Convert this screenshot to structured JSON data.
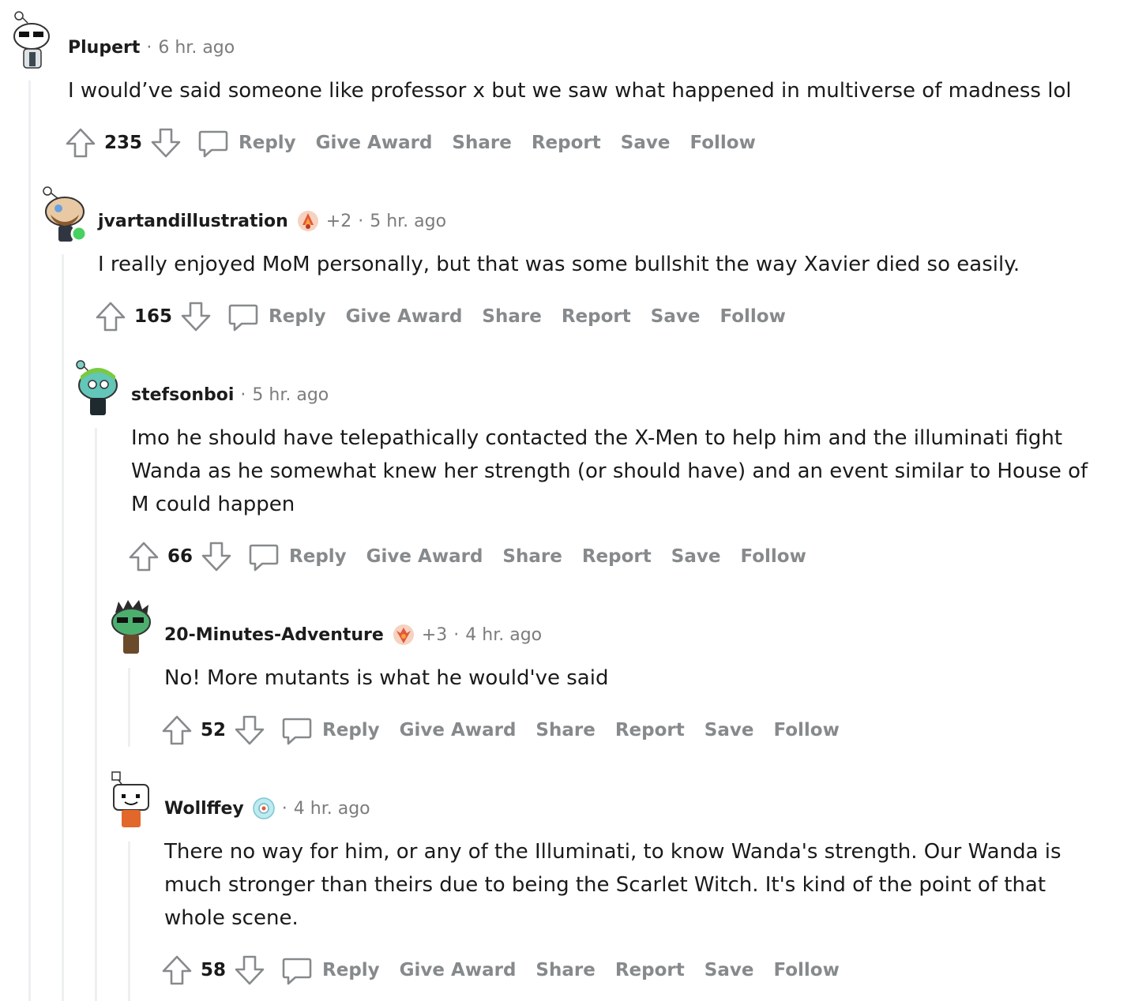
{
  "comments": [
    {
      "username": "Plupert",
      "award_plus": "",
      "time": "6 hr. ago",
      "body": "I would’ve said someone like professor x but we saw what happened in multiverse of madness lol",
      "score": "235"
    },
    {
      "username": "jvartandillustration",
      "award_plus": "+2",
      "time": "5 hr. ago",
      "body": "I really enjoyed MoM personally, but that was some bullshit the way Xavier died so easily.",
      "score": "165"
    },
    {
      "username": "stefsonboi",
      "award_plus": "",
      "time": "5 hr. ago",
      "body": "Imo he should have telepathically contacted the X-Men to help him and the illuminati fight Wanda as he somewhat knew her strength (or should have) and an event similar to House of M could happen",
      "score": "66"
    },
    {
      "username": "20-Minutes-Adventure",
      "award_plus": "+3",
      "time": "4 hr. ago",
      "body": "No! More mutants is what he would've said",
      "score": "52"
    },
    {
      "username": "Wollffey",
      "award_plus": "",
      "time": "4 hr. ago",
      "body": "There no way for him, or any of the Illuminati, to know Wanda's strength. Our Wanda is much stronger than theirs due to being the Scarlet Witch. It's kind of the point of that whole scene.",
      "score": "58"
    }
  ],
  "actions": {
    "reply": "Reply",
    "give_award": "Give Award",
    "share": "Share",
    "report": "Report",
    "save": "Save",
    "follow": "Follow"
  },
  "header_separator": "·",
  "colors": {
    "action_text": "#878a8c",
    "meta_text": "#7c7c7c",
    "thread_line": "#edeff1",
    "online_dot": "#46d160"
  },
  "icons": [
    "upvote-icon",
    "downvote-icon",
    "comment-icon",
    "award-icon",
    "avatar"
  ]
}
